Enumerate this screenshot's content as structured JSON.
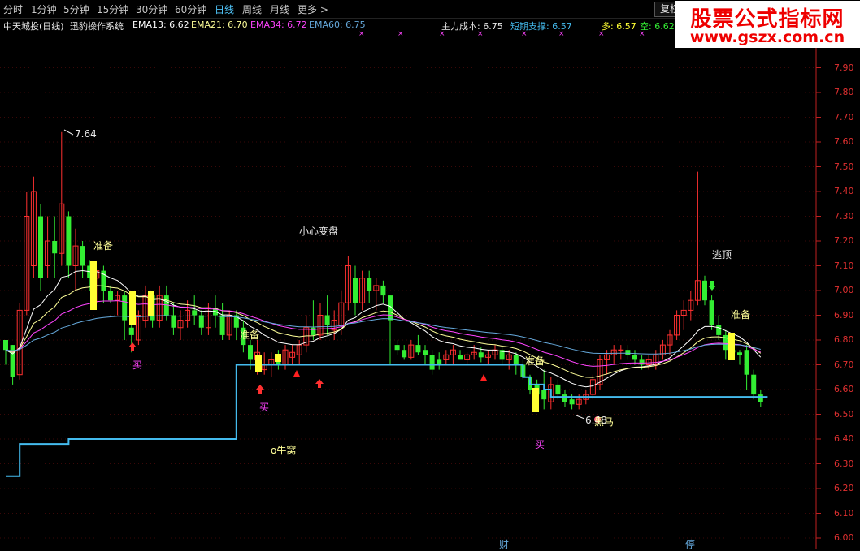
{
  "toolbar": {
    "periods": [
      "分时",
      "1分钟",
      "5分钟",
      "15分钟",
      "30分钟",
      "60分钟",
      "日线",
      "周线",
      "月线",
      "更多 >"
    ],
    "active_period": "日线",
    "fuquan_label": "复权"
  },
  "info": {
    "stock": "中天城投(日线)",
    "system": "迅豹操作系统",
    "ema13": "EMA13: 6.62",
    "ema21": "EMA21: 6.70",
    "ema34": "EMA34: 6.72",
    "ema60": "EMA60: 6.75",
    "main_cost": "主力成本: 6.75",
    "short_support": "短期支撑: 6.57",
    "duo": "多: 6.57",
    "kong": "空: 6.62"
  },
  "watermark": {
    "title": "股票公式指标网",
    "url": "www.gszx.com.cn"
  },
  "annotations": {
    "high_label": "7.64",
    "low_label": "6.48",
    "zhunbei": "准备",
    "xiaoxin": "小心变盘",
    "taoding": "逃顶",
    "mai": "买",
    "niuwo": "o牛窝",
    "heima": "黑马",
    "cai": "财",
    "ting": "停"
  },
  "colors": {
    "up": "#ff3030",
    "down": "#33ee33",
    "signal": "#ffff33",
    "ema13": "#ffffff",
    "ema21": "#ffff99",
    "ema34": "#ff44ff",
    "ema60": "#66aadd",
    "support": "#44bbee"
  },
  "chart_data": {
    "type": "candlestick",
    "yaxis": {
      "ticks": [
        "7.90",
        "7.80",
        "7.70",
        "7.60",
        "7.50",
        "7.40",
        "7.30",
        "7.20",
        "7.10",
        "7.00",
        "6.90",
        "6.80",
        "6.70",
        "6.60",
        "6.50",
        "6.40",
        "6.30",
        "6.20",
        "6.10",
        "6.00"
      ],
      "ylim": [
        6.0,
        7.95
      ]
    },
    "candles": [
      [
        6.8,
        6.8,
        6.7,
        6.76
      ],
      [
        6.78,
        6.78,
        6.62,
        6.65
      ],
      [
        6.66,
        6.95,
        6.64,
        6.92
      ],
      [
        6.92,
        7.4,
        6.9,
        7.3
      ],
      [
        7.1,
        7.46,
        7.05,
        7.4
      ],
      [
        7.3,
        7.35,
        7.0,
        7.05
      ],
      [
        7.1,
        7.3,
        7.05,
        7.2
      ],
      [
        7.2,
        7.3,
        7.05,
        7.15
      ],
      [
        7.15,
        7.64,
        7.1,
        7.35
      ],
      [
        7.3,
        7.32,
        7.05,
        7.1
      ],
      [
        7.1,
        7.25,
        7.0,
        7.18
      ],
      [
        7.18,
        7.2,
        7.05,
        7.1
      ],
      [
        7.1,
        7.12,
        7.0,
        7.05
      ],
      [
        7.05,
        7.08,
        6.95,
        7.08
      ],
      [
        7.08,
        7.1,
        6.95,
        7.0
      ],
      [
        7.0,
        7.02,
        6.95,
        6.96
      ],
      [
        6.96,
        7.0,
        6.9,
        6.98
      ],
      [
        6.98,
        7.0,
        6.8,
        6.88
      ],
      [
        6.85,
        6.9,
        6.75,
        6.82
      ],
      [
        6.8,
        6.92,
        6.78,
        6.9
      ],
      [
        6.88,
        7.02,
        6.85,
        6.98
      ],
      [
        6.98,
        7.0,
        6.85,
        6.88
      ],
      [
        6.88,
        7.02,
        6.85,
        6.98
      ],
      [
        6.98,
        7.02,
        6.88,
        6.9
      ],
      [
        6.9,
        6.95,
        6.82,
        6.85
      ],
      [
        6.85,
        6.92,
        6.8,
        6.88
      ],
      [
        6.88,
        6.96,
        6.85,
        6.92
      ],
      [
        6.92,
        6.98,
        6.86,
        6.9
      ],
      [
        6.9,
        6.92,
        6.82,
        6.85
      ],
      [
        6.85,
        6.95,
        6.82,
        6.93
      ],
      [
        6.93,
        6.98,
        6.85,
        6.9
      ],
      [
        6.9,
        6.95,
        6.8,
        6.82
      ],
      [
        6.82,
        6.92,
        6.8,
        6.9
      ],
      [
        6.9,
        6.92,
        6.8,
        6.85
      ],
      [
        6.85,
        6.88,
        6.75,
        6.78
      ],
      [
        6.78,
        6.8,
        6.68,
        6.72
      ],
      [
        6.72,
        6.8,
        6.66,
        6.75
      ],
      [
        6.68,
        6.75,
        6.66,
        6.7
      ],
      [
        6.7,
        6.75,
        6.65,
        6.72
      ],
      [
        6.72,
        6.76,
        6.68,
        6.7
      ],
      [
        6.7,
        6.78,
        6.68,
        6.76
      ],
      [
        6.73,
        6.78,
        6.7,
        6.75
      ],
      [
        6.74,
        6.8,
        6.7,
        6.78
      ],
      [
        6.78,
        6.9,
        6.75,
        6.85
      ],
      [
        6.85,
        6.96,
        6.8,
        6.82
      ],
      [
        6.82,
        6.95,
        6.8,
        6.9
      ],
      [
        6.9,
        6.98,
        6.82,
        6.86
      ],
      [
        6.84,
        6.92,
        6.8,
        6.88
      ],
      [
        6.86,
        7.0,
        6.82,
        6.95
      ],
      [
        6.95,
        7.14,
        6.92,
        7.1
      ],
      [
        7.05,
        7.1,
        6.9,
        6.95
      ],
      [
        6.95,
        7.08,
        6.92,
        7.05
      ],
      [
        7.05,
        7.08,
        6.95,
        7.0
      ],
      [
        7.0,
        7.05,
        6.92,
        7.02
      ],
      [
        7.02,
        7.04,
        6.95,
        6.98
      ],
      [
        6.98,
        6.98,
        6.7,
        6.88
      ],
      [
        6.78,
        6.8,
        6.74,
        6.76
      ],
      [
        6.76,
        6.78,
        6.72,
        6.73
      ],
      [
        6.73,
        6.8,
        6.72,
        6.78
      ],
      [
        6.78,
        6.82,
        6.74,
        6.75
      ],
      [
        6.76,
        6.78,
        6.7,
        6.74
      ],
      [
        6.74,
        6.76,
        6.66,
        6.68
      ],
      [
        6.72,
        6.75,
        6.68,
        6.7
      ],
      [
        6.72,
        6.76,
        6.7,
        6.74
      ],
      [
        6.74,
        6.78,
        6.7,
        6.76
      ],
      [
        6.74,
        6.76,
        6.72,
        6.72
      ],
      [
        6.72,
        6.75,
        6.7,
        6.74
      ],
      [
        6.74,
        6.78,
        6.72,
        6.75
      ],
      [
        6.75,
        6.77,
        6.71,
        6.73
      ],
      [
        6.73,
        6.76,
        6.7,
        6.74
      ],
      [
        6.74,
        6.78,
        6.72,
        6.76
      ],
      [
        6.76,
        6.78,
        6.7,
        6.72
      ],
      [
        6.72,
        6.76,
        6.68,
        6.74
      ],
      [
        6.74,
        6.75,
        6.66,
        6.7
      ],
      [
        6.7,
        6.72,
        6.64,
        6.65
      ],
      [
        6.65,
        6.66,
        6.58,
        6.6
      ],
      [
        6.62,
        6.64,
        6.54,
        6.58
      ],
      [
        6.6,
        6.68,
        6.52,
        6.56
      ],
      [
        6.55,
        6.65,
        6.52,
        6.62
      ],
      [
        6.62,
        6.64,
        6.56,
        6.58
      ],
      [
        6.58,
        6.6,
        6.53,
        6.55
      ],
      [
        6.56,
        6.58,
        6.52,
        6.54
      ],
      [
        6.54,
        6.58,
        6.52,
        6.56
      ],
      [
        6.56,
        6.6,
        6.54,
        6.58
      ],
      [
        6.58,
        6.66,
        6.56,
        6.64
      ],
      [
        6.62,
        6.74,
        6.6,
        6.72
      ],
      [
        6.72,
        6.76,
        6.66,
        6.74
      ],
      [
        6.74,
        6.78,
        6.7,
        6.76
      ],
      [
        6.76,
        6.78,
        6.72,
        6.76
      ],
      [
        6.76,
        6.78,
        6.72,
        6.74
      ],
      [
        6.74,
        6.76,
        6.7,
        6.72
      ],
      [
        6.72,
        6.74,
        6.68,
        6.7
      ],
      [
        6.7,
        6.74,
        6.68,
        6.72
      ],
      [
        6.7,
        6.76,
        6.68,
        6.74
      ],
      [
        6.74,
        6.8,
        6.72,
        6.78
      ],
      [
        6.78,
        6.84,
        6.74,
        6.82
      ],
      [
        6.82,
        6.92,
        6.8,
        6.9
      ],
      [
        6.9,
        6.96,
        6.84,
        6.92
      ],
      [
        6.92,
        7.0,
        6.88,
        6.96
      ],
      [
        6.96,
        7.48,
        6.94,
        7.04
      ],
      [
        7.04,
        7.06,
        6.94,
        6.96
      ],
      [
        6.96,
        6.98,
        6.84,
        6.86
      ],
      [
        6.86,
        6.9,
        6.8,
        6.82
      ],
      [
        6.82,
        6.84,
        6.72,
        6.76
      ],
      [
        6.76,
        6.78,
        6.72,
        6.75
      ],
      [
        6.75,
        6.76,
        6.7,
        6.74
      ],
      [
        6.76,
        6.78,
        6.6,
        6.66
      ],
      [
        6.66,
        6.68,
        6.56,
        6.58
      ],
      [
        6.58,
        6.6,
        6.53,
        6.55
      ]
    ],
    "support_line": [
      6.25,
      6.25,
      6.38,
      6.38,
      6.38,
      6.38,
      6.38,
      6.38,
      6.38,
      6.4,
      6.4,
      6.4,
      6.4,
      6.4,
      6.4,
      6.4,
      6.4,
      6.4,
      6.4,
      6.4,
      6.4,
      6.4,
      6.4,
      6.4,
      6.4,
      6.4,
      6.4,
      6.4,
      6.4,
      6.4,
      6.4,
      6.4,
      6.4,
      6.7,
      6.7,
      6.7,
      6.7,
      6.7,
      6.7,
      6.7,
      6.7,
      6.7,
      6.7,
      6.7,
      6.7,
      6.7,
      6.7,
      6.7,
      6.7,
      6.7,
      6.7,
      6.7,
      6.7,
      6.7,
      6.7,
      6.7,
      6.7,
      6.7,
      6.7,
      6.7,
      6.7,
      6.7,
      6.7,
      6.7,
      6.7,
      6.7,
      6.7,
      6.7,
      6.7,
      6.7,
      6.7,
      6.7,
      6.7,
      6.7,
      6.65,
      6.62,
      6.62,
      6.6,
      6.57,
      6.57,
      6.57,
      6.57,
      6.57,
      6.57,
      6.57,
      6.57,
      6.57,
      6.57,
      6.57,
      6.57,
      6.57,
      6.57,
      6.57,
      6.57,
      6.57,
      6.57,
      6.57,
      6.57,
      6.57,
      6.57,
      6.57,
      6.57,
      6.57,
      6.57,
      6.57,
      6.57,
      6.57,
      6.57,
      6.57,
      6.57
    ]
  }
}
